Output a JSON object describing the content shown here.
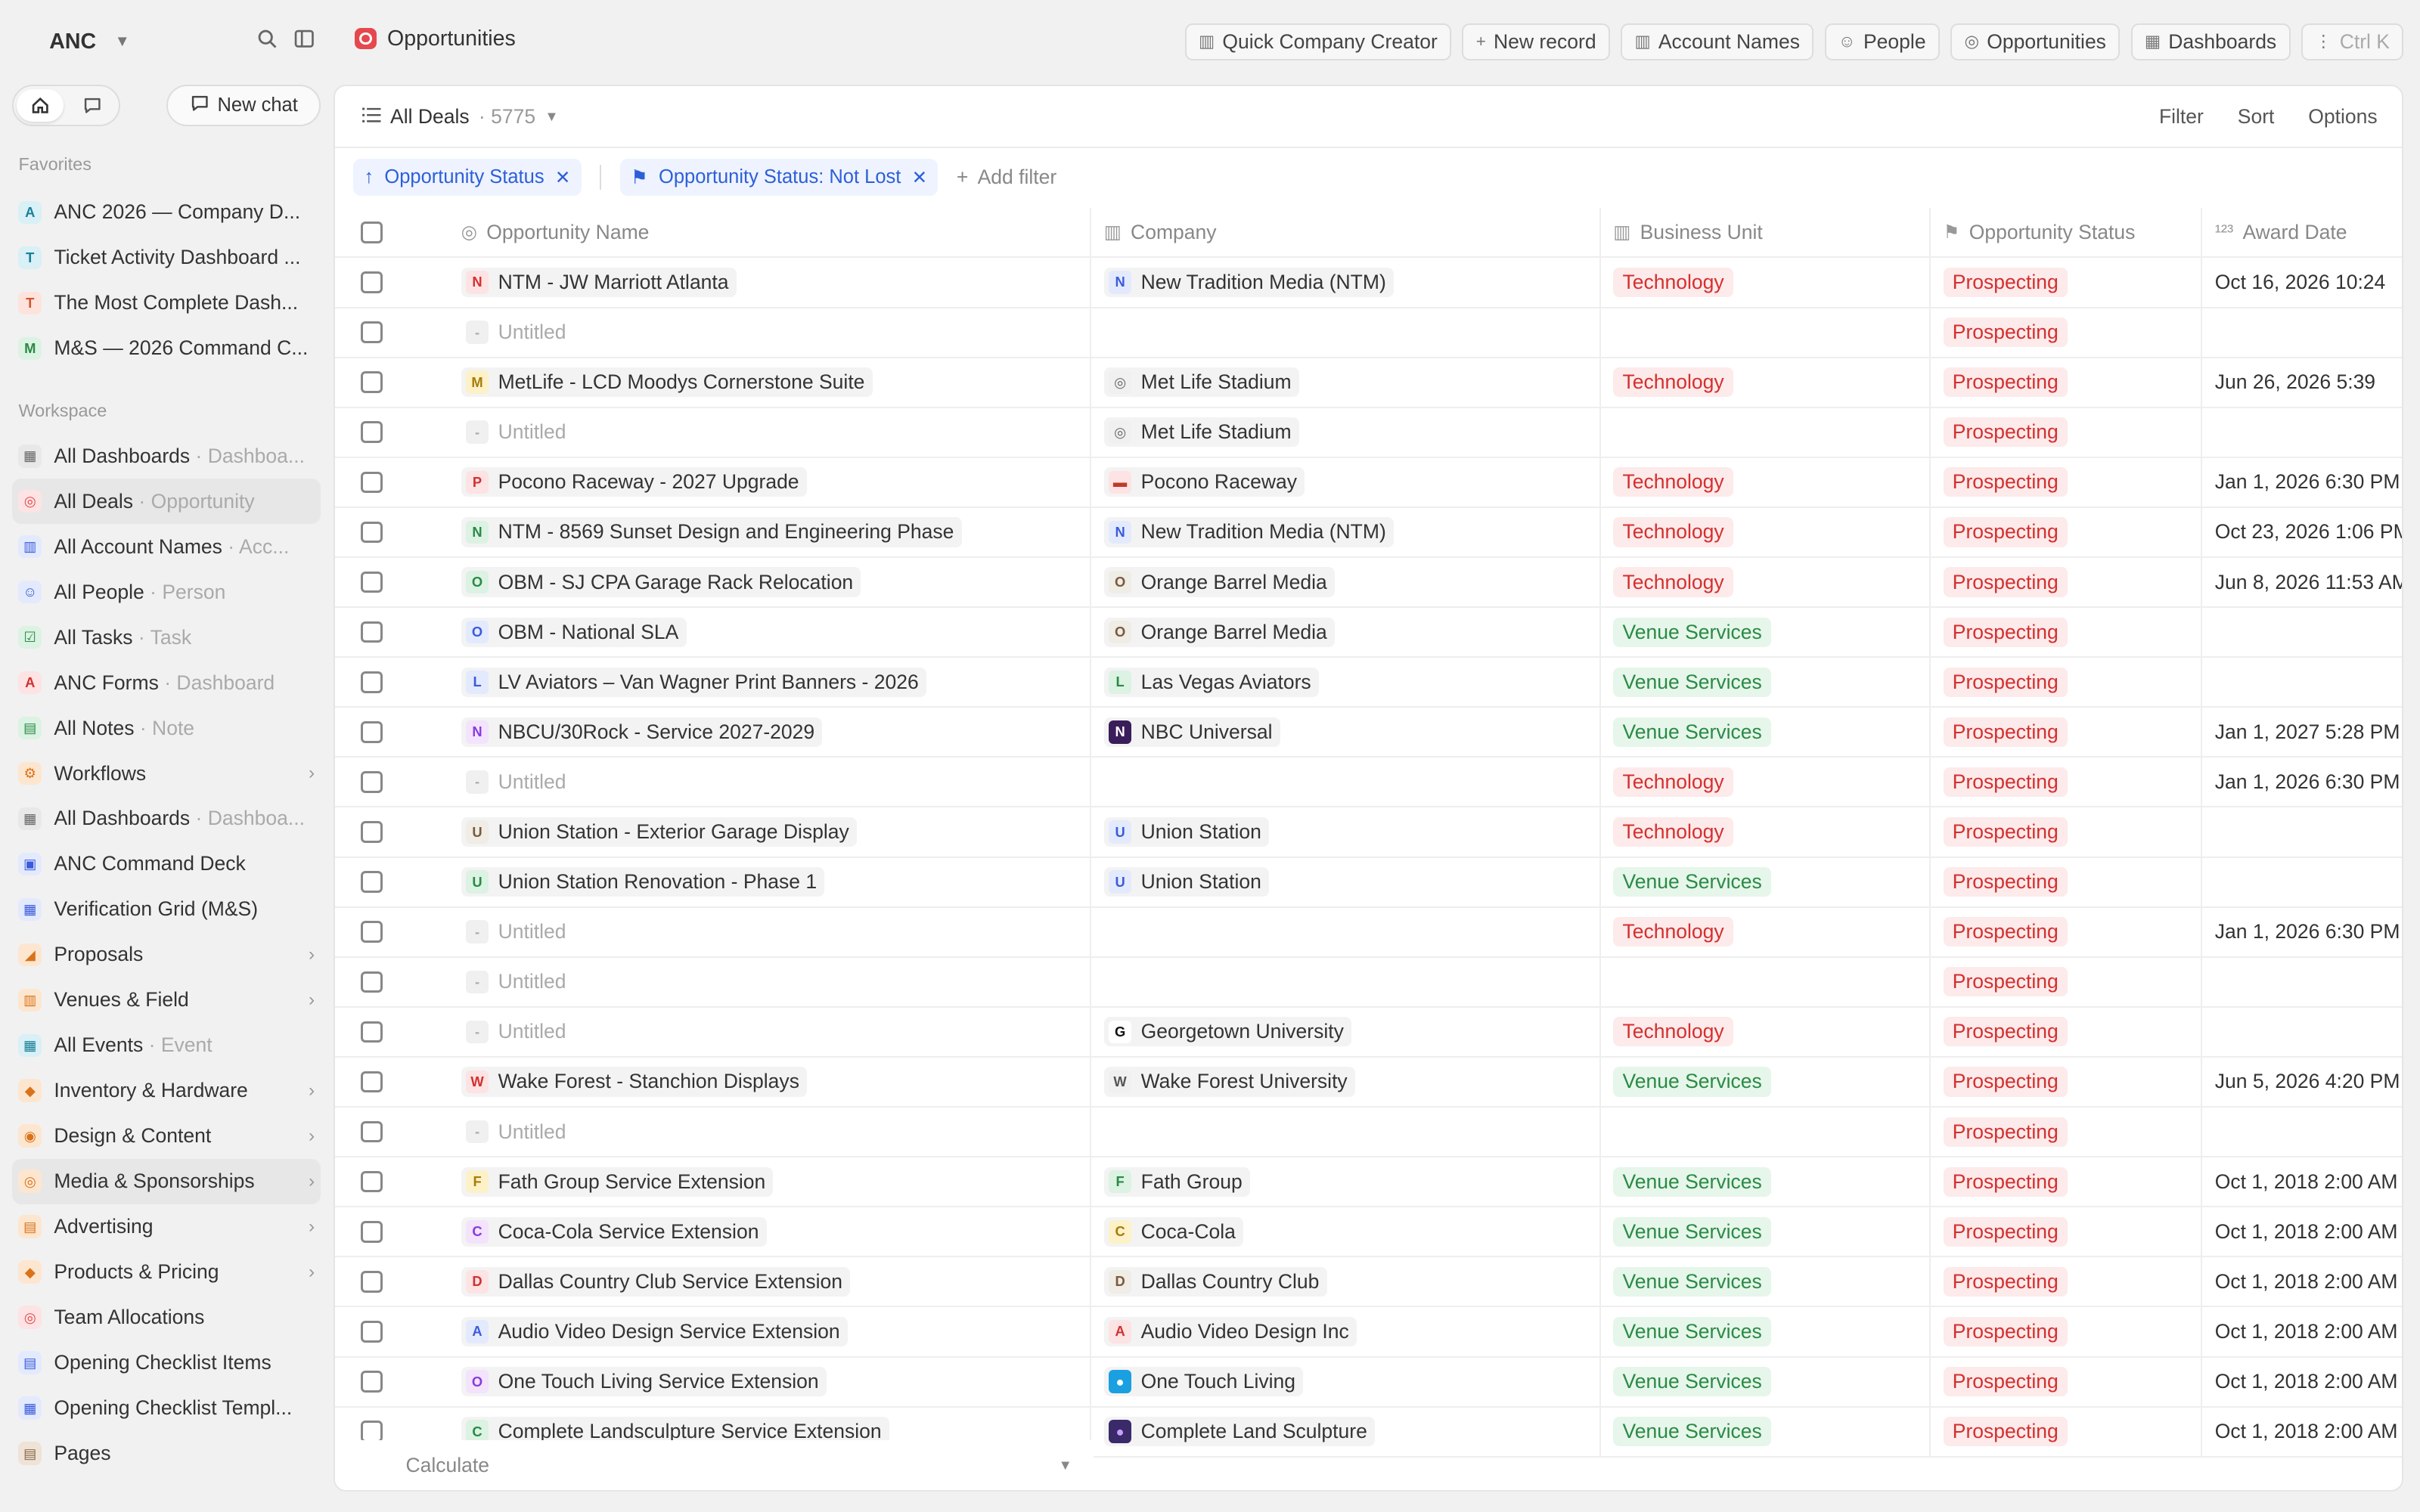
{
  "workspace": {
    "name": "ANC"
  },
  "sidebar": {
    "new_chat": "New chat",
    "favorites_label": "Favorites",
    "workspace_label": "Workspace",
    "favorites": [
      {
        "badge": "A",
        "badge_bg": "#d8f0f6",
        "badge_fg": "#1a7f99",
        "label": "ANC 2026 — Company D...",
        "sub": ""
      },
      {
        "badge": "T",
        "badge_bg": "#d8f0f6",
        "badge_fg": "#1a7f99",
        "label": "Ticket Activity Dashboard ...",
        "sub": ""
      },
      {
        "badge": "T",
        "badge_bg": "#fde3dc",
        "badge_fg": "#d2552f",
        "label": "The Most Complete Dash...",
        "sub": ""
      },
      {
        "badge": "M",
        "badge_bg": "#dcf2e3",
        "badge_fg": "#2a8a45",
        "label": "M&S — 2026 Command C...",
        "sub": ""
      }
    ],
    "items": [
      {
        "icon": "dashboard-icon",
        "glyph": "▦",
        "badge_bg": "#e8e8e8",
        "badge_fg": "#666",
        "label": "All Dashboards",
        "sub": " · Dashboa...",
        "chev": false
      },
      {
        "icon": "target-icon",
        "glyph": "◎",
        "badge_bg": "#fde3e3",
        "badge_fg": "#e5484d",
        "label": "All Deals",
        "sub": " · Opportunity",
        "chev": false
      },
      {
        "icon": "building-icon",
        "glyph": "▥",
        "badge_bg": "#e3eafd",
        "badge_fg": "#3b5bdb",
        "label": "All Account Names",
        "sub": " · Acc...",
        "chev": false
      },
      {
        "icon": "person-icon",
        "glyph": "☺",
        "badge_bg": "#e3eafd",
        "badge_fg": "#3b5bdb",
        "label": "All People",
        "sub": " · Person",
        "chev": false
      },
      {
        "icon": "checkbox-icon",
        "glyph": "☑",
        "badge_bg": "#dcf2e3",
        "badge_fg": "#2a8a45",
        "label": "All Tasks",
        "sub": " · Task",
        "chev": false
      },
      {
        "icon": "anc-forms-icon",
        "glyph": "A",
        "badge_bg": "#fde3e3",
        "badge_fg": "#d3302f",
        "label": "ANC Forms",
        "sub": " · Dashboard",
        "chev": false
      },
      {
        "icon": "notes-icon",
        "glyph": "▤",
        "badge_bg": "#dcf2e3",
        "badge_fg": "#2a8a45",
        "label": "All Notes",
        "sub": " · Note",
        "chev": false
      },
      {
        "icon": "workflow-icon",
        "glyph": "⚙",
        "badge_bg": "#fde6cf",
        "badge_fg": "#d9731a",
        "label": "Workflows",
        "sub": "",
        "chev": true
      },
      {
        "icon": "dashboard-icon",
        "glyph": "▦",
        "badge_bg": "#e8e8e8",
        "badge_fg": "#666",
        "label": "All Dashboards",
        "sub": " · Dashboa...",
        "chev": false
      },
      {
        "icon": "grid-icon",
        "glyph": "▣",
        "badge_bg": "#e3eafd",
        "badge_fg": "#3b5bdb",
        "label": "ANC Command Deck",
        "sub": "",
        "chev": false
      },
      {
        "icon": "table-icon",
        "glyph": "▦",
        "badge_bg": "#e3eafd",
        "badge_fg": "#3b5bdb",
        "label": "Verification Grid (M&S)",
        "sub": "",
        "chev": false
      },
      {
        "icon": "chart-icon",
        "glyph": "◢",
        "badge_bg": "#fde6cf",
        "badge_fg": "#d9731a",
        "label": "Proposals",
        "sub": "",
        "chev": true
      },
      {
        "icon": "clipboard-icon",
        "glyph": "▥",
        "badge_bg": "#fde6cf",
        "badge_fg": "#d9731a",
        "label": "Venues & Field",
        "sub": "",
        "chev": true
      },
      {
        "icon": "calendar-icon",
        "glyph": "▦",
        "badge_bg": "#d8f0f6",
        "badge_fg": "#1a7f99",
        "label": "All Events",
        "sub": " · Event",
        "chev": false
      },
      {
        "icon": "box-icon",
        "glyph": "◆",
        "badge_bg": "#fde6cf",
        "badge_fg": "#d9731a",
        "label": "Inventory & Hardware",
        "sub": "",
        "chev": true
      },
      {
        "icon": "palette-icon",
        "glyph": "◉",
        "badge_bg": "#fde6cf",
        "badge_fg": "#d9731a",
        "label": "Design & Content",
        "sub": "",
        "chev": true
      },
      {
        "icon": "broadcast-icon",
        "glyph": "◎",
        "badge_bg": "#fde6cf",
        "badge_fg": "#d9731a",
        "label": "Media & Sponsorships",
        "sub": "",
        "chev": true
      },
      {
        "icon": "megaphone-icon",
        "glyph": "▤",
        "badge_bg": "#fde6cf",
        "badge_fg": "#d9731a",
        "label": "Advertising",
        "sub": "",
        "chev": true
      },
      {
        "icon": "tag-icon",
        "glyph": "◆",
        "badge_bg": "#fde6cf",
        "badge_fg": "#d9731a",
        "label": "Products & Pricing",
        "sub": "",
        "chev": true
      },
      {
        "icon": "target-icon",
        "glyph": "◎",
        "badge_bg": "#fde3e3",
        "badge_fg": "#e5484d",
        "label": "Team Allocations",
        "sub": "",
        "chev": false
      },
      {
        "icon": "checklist-icon",
        "glyph": "▤",
        "badge_bg": "#e3eafd",
        "badge_fg": "#3b5bdb",
        "label": "Opening Checklist Items",
        "sub": "",
        "chev": false
      },
      {
        "icon": "template-icon",
        "glyph": "▦",
        "badge_bg": "#e3eafd",
        "badge_fg": "#3b5bdb",
        "label": "Opening Checklist Templ...",
        "sub": "",
        "chev": false
      },
      {
        "icon": "page-icon",
        "glyph": "▤",
        "badge_bg": "#eee3d6",
        "badge_fg": "#8a6a48",
        "label": "Pages",
        "sub": "",
        "chev": false
      }
    ],
    "active_index": 1,
    "hover_index": 16
  },
  "header": {
    "title": "Opportunities",
    "actions": [
      {
        "icon": "building-icon",
        "glyph": "▥",
        "label": "Quick Company Creator"
      },
      {
        "icon": "plus-icon",
        "glyph": "+",
        "label": "New record"
      },
      {
        "icon": "building-icon",
        "glyph": "▥",
        "label": "Account Names"
      },
      {
        "icon": "person-icon",
        "glyph": "☺",
        "label": "People"
      },
      {
        "icon": "target-icon",
        "glyph": "◎",
        "label": "Opportunities"
      },
      {
        "icon": "dashboard-icon",
        "glyph": "▦",
        "label": "Dashboards"
      }
    ],
    "more_label": "Ctrl K"
  },
  "view": {
    "name": "All Deals",
    "count": "· 5775",
    "options": [
      "Filter",
      "Sort",
      "Options"
    ]
  },
  "filters": {
    "sort_chip": "Opportunity Status",
    "filter_chip": "Opportunity Status: Not Lost",
    "add_filter": "Add filter"
  },
  "table": {
    "columns": [
      {
        "icon": "target-icon",
        "glyph": "◎",
        "label": "Opportunity Name"
      },
      {
        "icon": "building-icon",
        "glyph": "▥",
        "label": "Company"
      },
      {
        "icon": "business-unit-icon",
        "glyph": "▥",
        "label": "Business Unit"
      },
      {
        "icon": "flag-icon",
        "glyph": "⚑",
        "label": "Opportunity Status"
      },
      {
        "icon": "number-icon",
        "glyph": "¹²³",
        "label": "Award Date"
      }
    ],
    "rows": [
      {
        "name": "NTM - JW Marriott Atlanta",
        "ni": "N",
        "nbg": "#fde3e3",
        "nfg": "#d3302f",
        "company": "New Tradition Media (NTM)",
        "ci": "N",
        "cbg": "#e3eafd",
        "cfg": "#3b5bdb",
        "bu": "Technology",
        "status": "Prospecting",
        "award": "Oct 16, 2026 10:24"
      },
      {
        "name": "Untitled",
        "ni": "-",
        "nbg": "#f0f0f0",
        "nfg": "#aaa",
        "company": "",
        "ci": "",
        "cbg": "",
        "cfg": "",
        "bu": "",
        "status": "Prospecting",
        "award": ""
      },
      {
        "name": "MetLife - LCD Moodys Cornerstone Suite",
        "ni": "M",
        "nbg": "#fdf1c8",
        "nfg": "#a77d0a",
        "company": "Met Life Stadium",
        "ci": "◎",
        "cbg": "#f0f0f0",
        "cfg": "#666",
        "bu": "Technology",
        "status": "Prospecting",
        "award": "Jun 26, 2026 5:39"
      },
      {
        "name": "Untitled",
        "ni": "-",
        "nbg": "#f0f0f0",
        "nfg": "#aaa",
        "company": "Met Life Stadium",
        "ci": "◎",
        "cbg": "#f0f0f0",
        "cfg": "#666",
        "bu": "",
        "status": "Prospecting",
        "award": ""
      },
      {
        "name": "Pocono Raceway - 2027 Upgrade",
        "ni": "P",
        "nbg": "#fde3e3",
        "nfg": "#d3302f",
        "company": "Pocono Raceway",
        "ci": "▬",
        "cbg": "#fde3e3",
        "cfg": "#c0392b",
        "bu": "Technology",
        "status": "Prospecting",
        "award": "Jan 1, 2026 6:30 PM"
      },
      {
        "name": "NTM - 8569 Sunset Design and Engineering Phase",
        "ni": "N",
        "nbg": "#dcf2e3",
        "nfg": "#2a8a45",
        "company": "New Tradition Media (NTM)",
        "ci": "N",
        "cbg": "#e3eafd",
        "cfg": "#3b5bdb",
        "bu": "Technology",
        "status": "Prospecting",
        "award": "Oct 23, 2026 1:06 PM"
      },
      {
        "name": "OBM - SJ CPA Garage Rack Relocation",
        "ni": "O",
        "nbg": "#dcf2e3",
        "nfg": "#2a8a45",
        "company": "Orange Barrel Media",
        "ci": "O",
        "cbg": "#f0ece6",
        "cfg": "#7a5a3a",
        "bu": "Technology",
        "status": "Prospecting",
        "award": "Jun 8, 2026 11:53 AM"
      },
      {
        "name": "OBM - National SLA",
        "ni": "O",
        "nbg": "#e3eafd",
        "nfg": "#3b5bdb",
        "company": "Orange Barrel Media",
        "ci": "O",
        "cbg": "#f0ece6",
        "cfg": "#7a5a3a",
        "bu": "Venue Services",
        "status": "Prospecting",
        "award": ""
      },
      {
        "name": "LV Aviators – Van Wagner Print Banners - 2026",
        "ni": "L",
        "nbg": "#e3eafd",
        "nfg": "#3b5bdb",
        "company": "Las Vegas Aviators",
        "ci": "L",
        "cbg": "#dcf2e3",
        "cfg": "#2a8a45",
        "bu": "Venue Services",
        "status": "Prospecting",
        "award": ""
      },
      {
        "name": "NBCU/30Rock - Service 2027-2029",
        "ni": "N",
        "nbg": "#f3e3fd",
        "nfg": "#8a3bdb",
        "company": "NBC Universal",
        "ci": "N",
        "cbg": "#3a1e5a",
        "cfg": "#fff",
        "bu": "Venue Services",
        "status": "Prospecting",
        "award": "Jan 1, 2027 5:28 PM"
      },
      {
        "name": "Untitled",
        "ni": "-",
        "nbg": "#f0f0f0",
        "nfg": "#aaa",
        "company": "",
        "ci": "",
        "cbg": "",
        "cfg": "",
        "bu": "Technology",
        "status": "Prospecting",
        "award": "Jan 1, 2026 6:30 PM"
      },
      {
        "name": "Union Station - Exterior Garage Display",
        "ni": "U",
        "nbg": "#f0ece6",
        "nfg": "#7a5a3a",
        "company": "Union Station",
        "ci": "U",
        "cbg": "#e3eafd",
        "cfg": "#3b5bdb",
        "bu": "Technology",
        "status": "Prospecting",
        "award": ""
      },
      {
        "name": "Union Station Renovation - Phase 1",
        "ni": "U",
        "nbg": "#dcf2e3",
        "nfg": "#2a8a45",
        "company": "Union Station",
        "ci": "U",
        "cbg": "#e3eafd",
        "cfg": "#3b5bdb",
        "bu": "Venue Services",
        "status": "Prospecting",
        "award": ""
      },
      {
        "name": "Untitled",
        "ni": "-",
        "nbg": "#f0f0f0",
        "nfg": "#aaa",
        "company": "",
        "ci": "",
        "cbg": "",
        "cfg": "",
        "bu": "Technology",
        "status": "Prospecting",
        "award": "Jan 1, 2026 6:30 PM"
      },
      {
        "name": "Untitled",
        "ni": "-",
        "nbg": "#f0f0f0",
        "nfg": "#aaa",
        "company": "",
        "ci": "",
        "cbg": "",
        "cfg": "",
        "bu": "",
        "status": "Prospecting",
        "award": ""
      },
      {
        "name": "Untitled",
        "ni": "-",
        "nbg": "#f0f0f0",
        "nfg": "#aaa",
        "company": "Georgetown University",
        "ci": "G",
        "cbg": "#fff",
        "cfg": "#111",
        "bu": "Technology",
        "status": "Prospecting",
        "award": ""
      },
      {
        "name": "Wake Forest - Stanchion Displays",
        "ni": "W",
        "nbg": "#fde3e3",
        "nfg": "#d3302f",
        "company": "Wake Forest University",
        "ci": "W",
        "cbg": "#f0f0f0",
        "cfg": "#555",
        "bu": "Venue Services",
        "status": "Prospecting",
        "award": "Jun 5, 2026 4:20 PM"
      },
      {
        "name": "Untitled",
        "ni": "-",
        "nbg": "#f0f0f0",
        "nfg": "#aaa",
        "company": "",
        "ci": "",
        "cbg": "",
        "cfg": "",
        "bu": "",
        "status": "Prospecting",
        "award": ""
      },
      {
        "name": "Fath Group Service Extension",
        "ni": "F",
        "nbg": "#fdf1c8",
        "nfg": "#a77d0a",
        "company": "Fath Group",
        "ci": "F",
        "cbg": "#dcf2e3",
        "cfg": "#2a8a45",
        "bu": "Venue Services",
        "status": "Prospecting",
        "award": "Oct 1, 2018 2:00 AM"
      },
      {
        "name": "Coca-Cola Service Extension",
        "ni": "C",
        "nbg": "#f3e3fd",
        "nfg": "#8a3bdb",
        "company": "Coca-Cola",
        "ci": "C",
        "cbg": "#fdf1c8",
        "cfg": "#a77d0a",
        "bu": "Venue Services",
        "status": "Prospecting",
        "award": "Oct 1, 2018 2:00 AM"
      },
      {
        "name": "Dallas Country Club Service Extension",
        "ni": "D",
        "nbg": "#fde3e3",
        "nfg": "#d3302f",
        "company": "Dallas Country Club",
        "ci": "D",
        "cbg": "#f0ece6",
        "cfg": "#7a5a3a",
        "bu": "Venue Services",
        "status": "Prospecting",
        "award": "Oct 1, 2018 2:00 AM"
      },
      {
        "name": "Audio Video Design Service Extension",
        "ni": "A",
        "nbg": "#e3eafd",
        "nfg": "#3b5bdb",
        "company": "Audio Video Design Inc",
        "ci": "A",
        "cbg": "#fde3e3",
        "cfg": "#d3302f",
        "bu": "Venue Services",
        "status": "Prospecting",
        "award": "Oct 1, 2018 2:00 AM"
      },
      {
        "name": "One Touch Living Service Extension",
        "ni": "O",
        "nbg": "#f3e3fd",
        "nfg": "#8a3bdb",
        "company": "One Touch Living",
        "ci": "●",
        "cbg": "#1aa0e0",
        "cfg": "#fff",
        "bu": "Venue Services",
        "status": "Prospecting",
        "award": "Oct 1, 2018 2:00 AM"
      },
      {
        "name": "Complete Landsculpture Service Extension",
        "ni": "C",
        "nbg": "#dcf2e3",
        "nfg": "#2a8a45",
        "company": "Complete Land Sculpture",
        "ci": "●",
        "cbg": "#3a2a6a",
        "cfg": "#c9a0ff",
        "bu": "Venue Services",
        "status": "Prospecting",
        "award": "Oct 1, 2018 2:00 AM"
      }
    ],
    "calculate_label": "Calculate"
  }
}
